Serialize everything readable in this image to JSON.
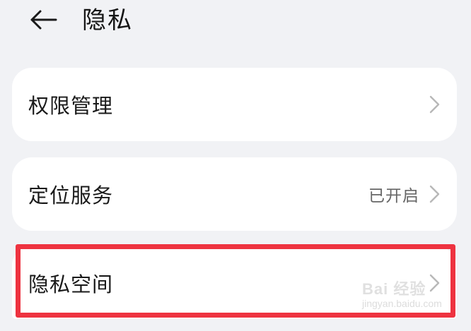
{
  "header": {
    "title": "隐私",
    "back_icon": "arrow-left-icon"
  },
  "settings": [
    {
      "label": "权限管理",
      "status": "",
      "icon": "chevron-right-icon"
    },
    {
      "label": "定位服务",
      "status": "已开启",
      "icon": "chevron-right-icon"
    },
    {
      "label": "隐私空间",
      "status": "",
      "icon": "chevron-right-icon"
    }
  ],
  "highlight": {
    "target": "隐私空间",
    "color": "#ee3340"
  },
  "watermark": {
    "logo": "Bai 经验",
    "url": "jingyan.baidu.com"
  },
  "colors": {
    "background": "#f1f2f5",
    "card": "#ffffff",
    "text_primary": "#1a1a1a",
    "text_secondary": "#666666",
    "chevron": "#b8b8b8"
  }
}
